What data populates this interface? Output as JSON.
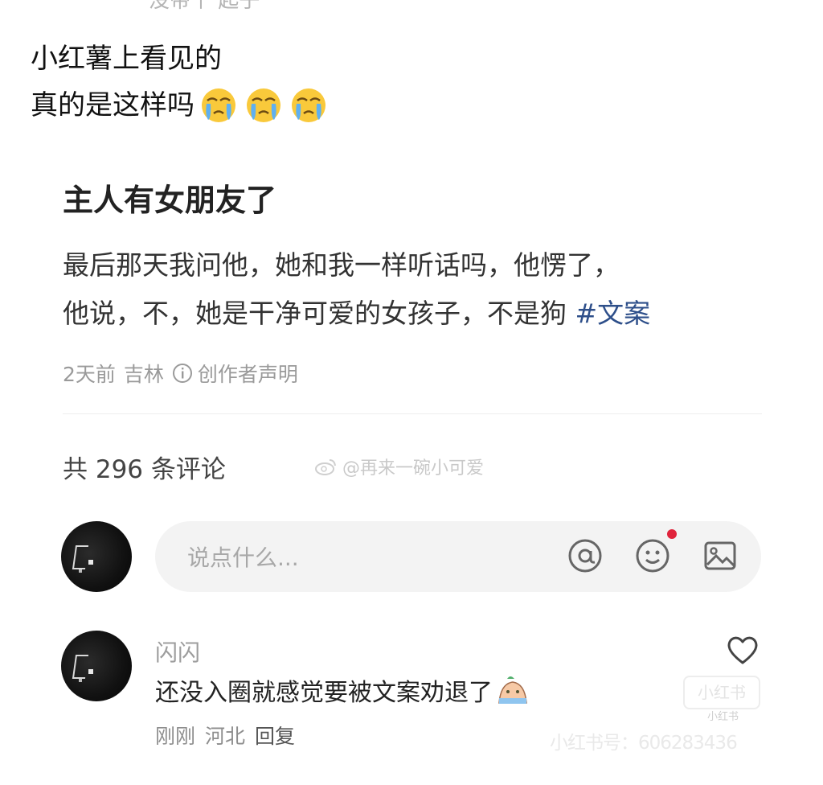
{
  "top_cut_text": "没带个 起子",
  "post": {
    "line1": "小红薯上看见的",
    "line2": "真的是这样吗",
    "emojis": [
      "crying-face-emoji",
      "crying-face-emoji",
      "crying-face-emoji"
    ]
  },
  "card": {
    "title": "主人有女朋友了",
    "body_line1": "最后那天我问他，她和我一样听话吗，他愣了，",
    "body_line2": "他说，不，她是干净可爱的女孩子，不是狗 ",
    "hashtag": "#文案",
    "meta_time": "2天前",
    "meta_location": "吉林",
    "meta_declaration": "创作者声明"
  },
  "comments": {
    "count_label": "共 296 条评论",
    "weibo_watermark": "@再来一碗小可爱",
    "input_placeholder": "说点什么...",
    "items": [
      {
        "username": "闪闪",
        "text": "还没入圈就感觉要被文案劝退了",
        "time": "刚刚",
        "location": "河北",
        "reply_label": "回复"
      }
    ]
  },
  "watermark": {
    "logo_text": "小红书",
    "small_text": "小红书",
    "id_text": "小红书号：606283436"
  },
  "colors": {
    "hashtag": "#2e4f8a",
    "notification_dot": "#e0243c"
  }
}
